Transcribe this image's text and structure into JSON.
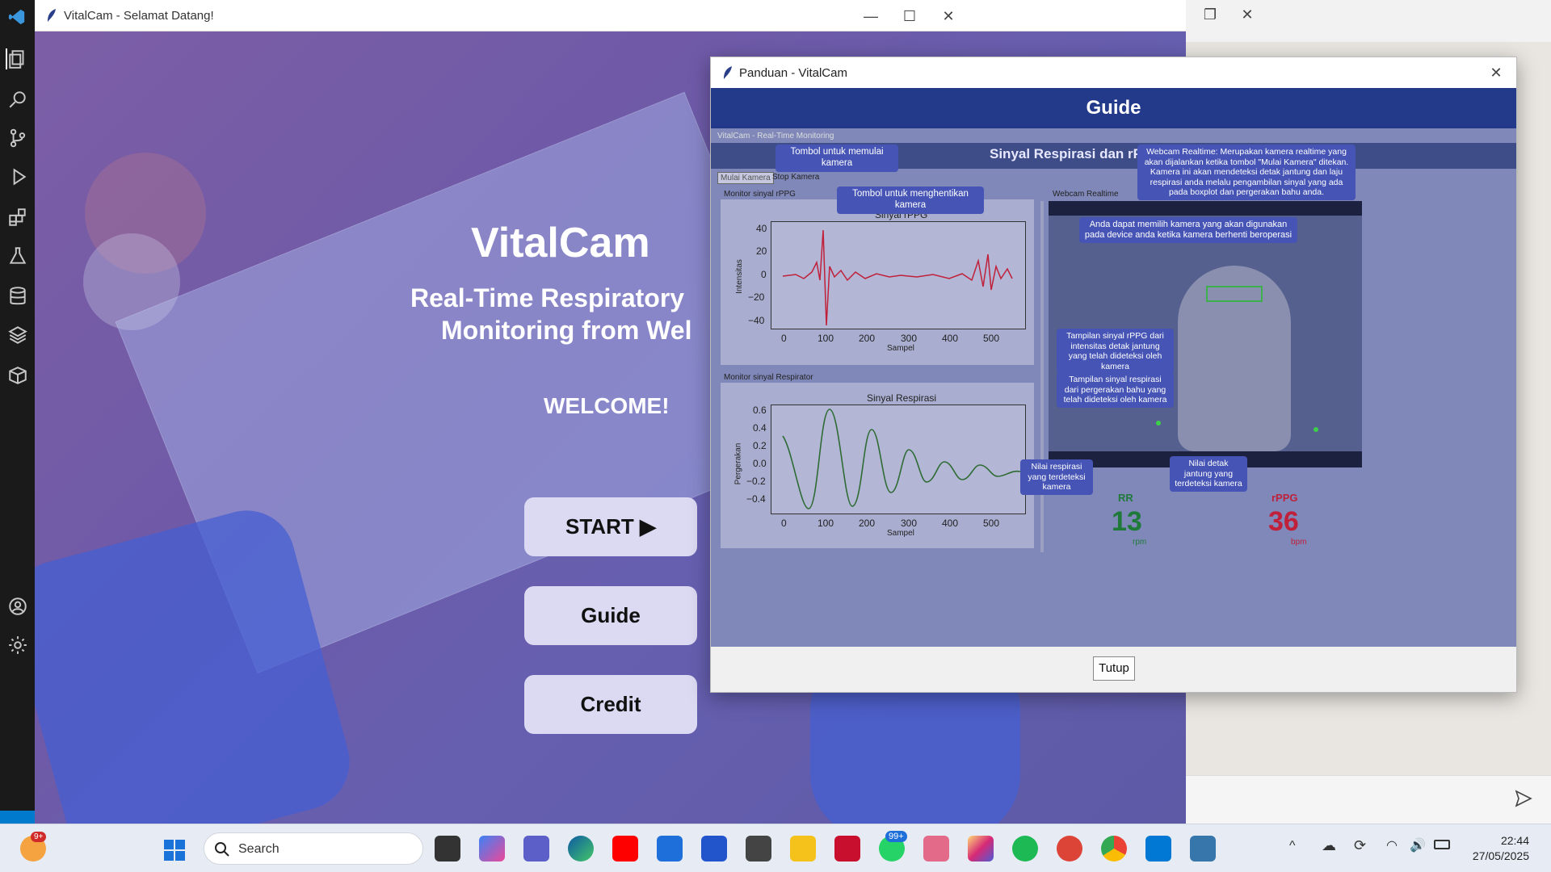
{
  "main_window": {
    "title": "VitalCam - Selamat Datang!",
    "app_title": "VitalCam",
    "subtitle_line1": "Real-Time Respiratory",
    "subtitle_line2": "Monitoring from Wel",
    "welcome": "WELCOME!",
    "buttons": {
      "start": "START ▶",
      "guide": "Guide",
      "credit": "Credit"
    }
  },
  "guide_window": {
    "title": "Panduan - VitalCam",
    "header": "Guide",
    "close_button": "Tutup",
    "screenshot": {
      "window_title": "VitalCam - Real-Time Monitoring",
      "header_text": "Sinyal Respirasi dan rPPG Real-Time",
      "btn_start": "Mulai Kamera",
      "btn_stop": "Stop Kamera",
      "label_rppg_monitor": "Monitor sinyal rPPG",
      "label_resp_monitor": "Monitor sinyal Respirator",
      "label_webcam": "Webcam Realtime",
      "rppg_plot": {
        "title": "Sinyal rPPG",
        "xlabel": "Sampel",
        "ylabel": "Intensitas",
        "yticks": [
          "40",
          "20",
          "0",
          "−20",
          "−40"
        ],
        "xticks": [
          "0",
          "100",
          "200",
          "300",
          "400",
          "500"
        ]
      },
      "resp_plot": {
        "title": "Sinyal Respirasi",
        "xlabel": "Sampel",
        "ylabel": "Pergerakan",
        "yticks": [
          "0.6",
          "0.4",
          "0.2",
          "0.0",
          "−0.2",
          "−0.4"
        ],
        "xticks": [
          "0",
          "100",
          "200",
          "300",
          "400",
          "500"
        ]
      },
      "callouts": {
        "start": "Tombol untuk memulai kamera",
        "stop": "Tombol untuk menghentikan kamera",
        "webcam": "Webcam Realtime: Merupakan kamera realtime yang akan dijalankan ketika tombol \"Mulai Kamera\" ditekan. Kamera ini akan mendeteksi detak jantung dan laju respirasi anda melalu pengambilan sinyal yang ada pada boxplot dan pergerakan bahu anda.",
        "camera_select": "Anda dapat memilih kamera yang akan digunakan pada device anda ketika kamera berhenti beroperasi",
        "rppg_display": "Tampilan sinyal rPPG dari intensitas detak jantung yang telah dideteksi oleh kamera",
        "resp_display": "Tampilan sinyal respirasi dari pergerakan bahu yang telah dideteksi oleh kamera",
        "rr_value": "Nilai respirasi yang terdeteksi kamera",
        "hr_value": "Nilai detak jantung yang terdeteksi kamera"
      },
      "rr": {
        "label": "RR",
        "value": "13",
        "unit": "rpm"
      },
      "rppg": {
        "label": "rPPG",
        "value": "36",
        "unit": "bpm"
      }
    }
  },
  "taskbar": {
    "search_placeholder": "Search",
    "badge_left": "9+",
    "badge_whatsapp": "99+",
    "time": "22:44",
    "date": "27/05/2025"
  },
  "colors": {
    "guide_header": "#23398a",
    "callout": "#4654b5",
    "rr_green": "#1f7a3a",
    "rppg_red": "#c0203a"
  }
}
